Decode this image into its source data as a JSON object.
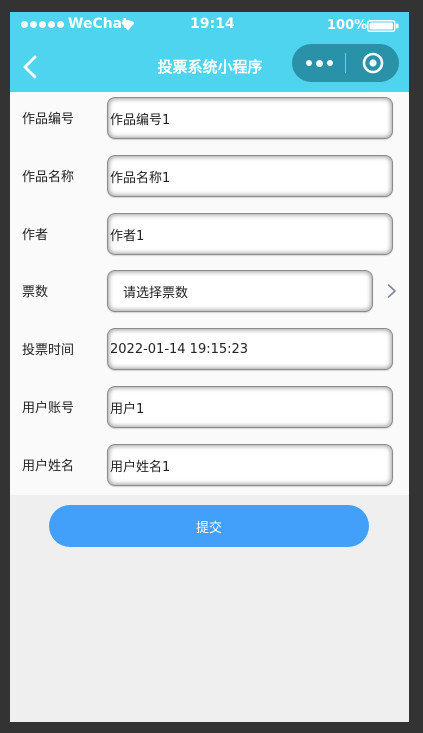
{
  "status_bar": {
    "carrier": "WeChat",
    "time": "19:14",
    "battery": "100%"
  },
  "nav": {
    "title": "投票系统小程序"
  },
  "form": {
    "fields": [
      {
        "label": "作品编号",
        "value": "作品编号1"
      },
      {
        "label": "作品名称",
        "value": "作品名称1"
      },
      {
        "label": "作者",
        "value": "作者1"
      },
      {
        "label": "票数",
        "value": "请选择票数"
      },
      {
        "label": "投票时间",
        "value": "2022-01-14 19:15:23"
      },
      {
        "label": "用户账号",
        "value": "用户1"
      },
      {
        "label": "用户姓名",
        "value": "用户姓名1"
      }
    ],
    "submit_label": "提交"
  },
  "colors": {
    "header_bg": "#4ed4ef",
    "capsule_bg": "#2a92a8",
    "submit_bg": "#429ffa"
  }
}
